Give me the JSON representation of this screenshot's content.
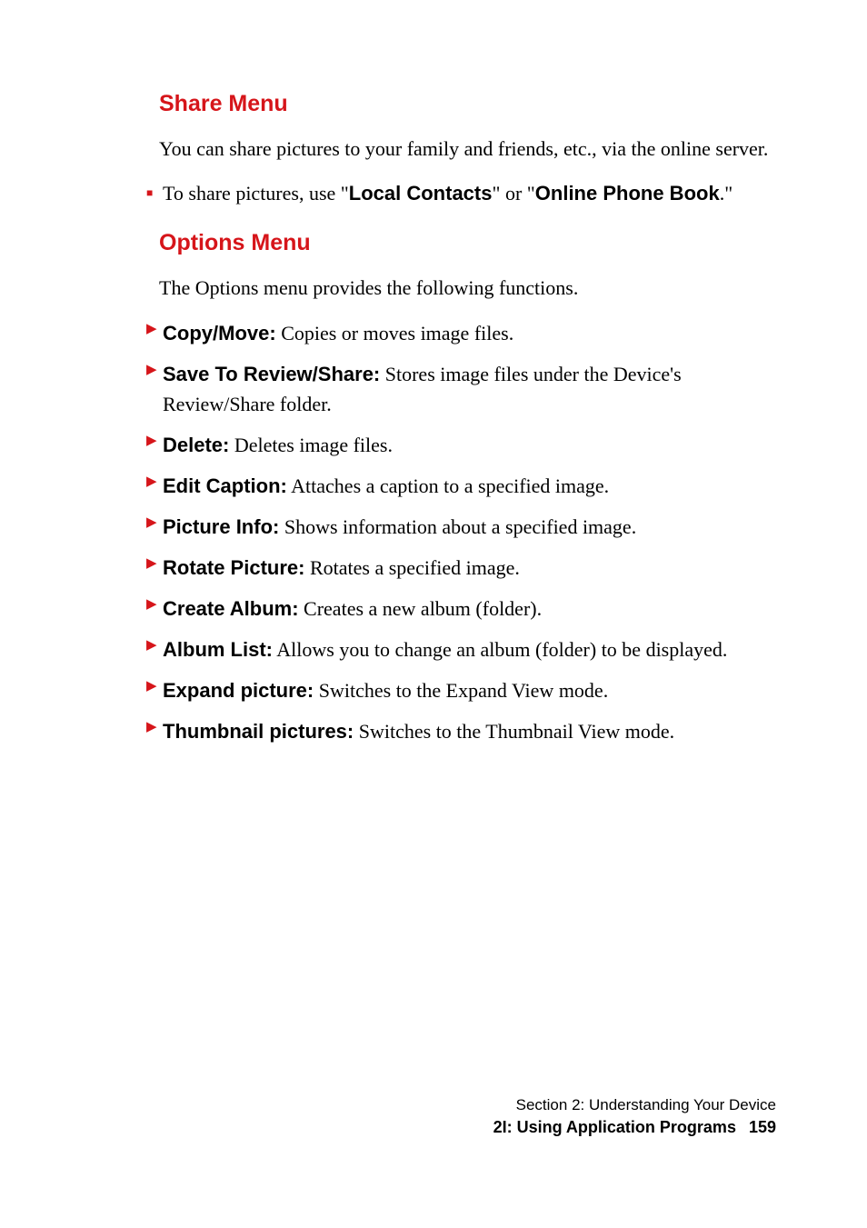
{
  "sections": {
    "share_menu": {
      "heading": "Share Menu",
      "intro": "You can share pictures to your family and friends, etc., via the online server.",
      "bullet_prefix": "To share pictures, use \"",
      "bullet_bold1": "Local Contacts",
      "bullet_mid": "\" or \"",
      "bullet_bold2": "Online Phone Book",
      "bullet_suffix": ".\""
    },
    "options_menu": {
      "heading": "Options Menu",
      "intro": "The Options menu provides the following functions.",
      "items": [
        {
          "label": "Copy/Move:",
          "desc": " Copies or moves image files."
        },
        {
          "label": "Save To Review/Share:",
          "desc": " Stores image files under the Device's Review/Share folder."
        },
        {
          "label": "Delete:",
          "desc": " Deletes image files."
        },
        {
          "label": "Edit Caption:",
          "desc": " Attaches a caption to a specified image."
        },
        {
          "label": "Picture Info:",
          "desc": " Shows information about a specified image."
        },
        {
          "label": "Rotate Picture:",
          "desc": " Rotates a specified image."
        },
        {
          "label": "Create Album:",
          "desc": " Creates a new album (folder)."
        },
        {
          "label": "Album List:",
          "desc": " Allows you to change an album (folder) to be displayed."
        },
        {
          "label": "Expand picture:",
          "desc": " Switches to the Expand View mode."
        },
        {
          "label": "Thumbnail pictures:",
          "desc": " Switches to the Thumbnail View mode."
        }
      ]
    }
  },
  "footer": {
    "section_line": "Section 2: Understanding Your Device",
    "sub_line": "2I: Using Application Programs",
    "page_number": "159"
  }
}
